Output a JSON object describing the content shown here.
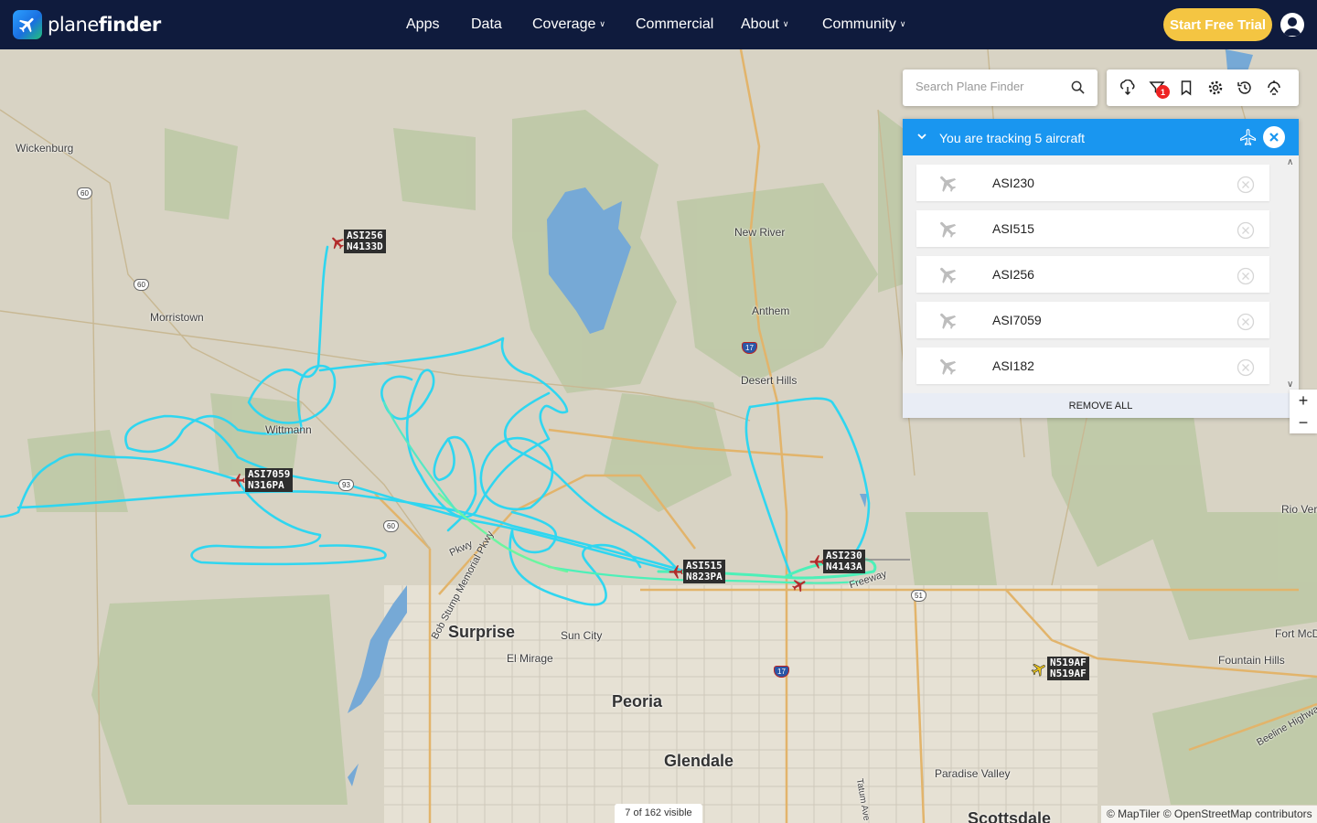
{
  "brand": {
    "name_a": "plane",
    "name_b": "finder"
  },
  "nav": {
    "items": [
      {
        "label": "Apps",
        "dropdown": false
      },
      {
        "label": "Data",
        "dropdown": false
      },
      {
        "label": "Coverage",
        "dropdown": true
      },
      {
        "label": "Commercial",
        "dropdown": false
      },
      {
        "label": "About",
        "dropdown": true
      },
      {
        "label": "Community",
        "dropdown": true
      }
    ],
    "cta": "Start Free Trial"
  },
  "search": {
    "placeholder": "Search Plane Finder",
    "value": ""
  },
  "tools": {
    "icons": [
      "weather-icon",
      "filter-icon",
      "bookmark-icon",
      "settings-icon",
      "playback-icon",
      "airport-icon"
    ],
    "filter_badge": "1"
  },
  "tracking": {
    "title": "You are tracking 5 aircraft",
    "aircraft": [
      "ASI230",
      "ASI515",
      "ASI256",
      "ASI7059",
      "ASI182"
    ],
    "remove_all": "REMOVE ALL"
  },
  "zoom": {
    "in": "+",
    "out": "−"
  },
  "status": {
    "visible": "7 of 162 visible"
  },
  "attribution": "© MapTiler © OpenStreetMap contributors",
  "map_labels": {
    "wickenburg": "Wickenburg",
    "morristown": "Morristown",
    "wittmann": "Wittmann",
    "new_river": "New River",
    "anthem": "Anthem",
    "desert_hills": "Desert Hills",
    "surprise": "Surprise",
    "sun_city": "Sun City",
    "el_mirage": "El Mirage",
    "peoria": "Peoria",
    "glendale": "Glendale",
    "paradise_valley": "Paradise Valley",
    "fountain_hills": "Fountain Hills",
    "rio_verde": "Rio Verd",
    "fort_mcd": "Fort McD",
    "scottsdale": "Scottsdale",
    "bob_stump": "Bob Stump Memorial Pkwy",
    "beeline": "Beeline Highwa",
    "freeway": "Freeway",
    "pkwy": "Pkwy",
    "hwy_60": "60",
    "hwy_93": "93",
    "hwy_17": "17",
    "hwy_51": "51",
    "tatum": "Tatum Ave"
  },
  "flights": [
    {
      "callsign": "ASI256",
      "reg": "N4133D"
    },
    {
      "callsign": "ASI7059",
      "reg": "N316PA"
    },
    {
      "callsign": "ASI515",
      "reg": "N823PA"
    },
    {
      "callsign": "ASI230",
      "reg": "N4143A"
    },
    {
      "callsign": "N519AF",
      "reg": "N519AF"
    }
  ]
}
